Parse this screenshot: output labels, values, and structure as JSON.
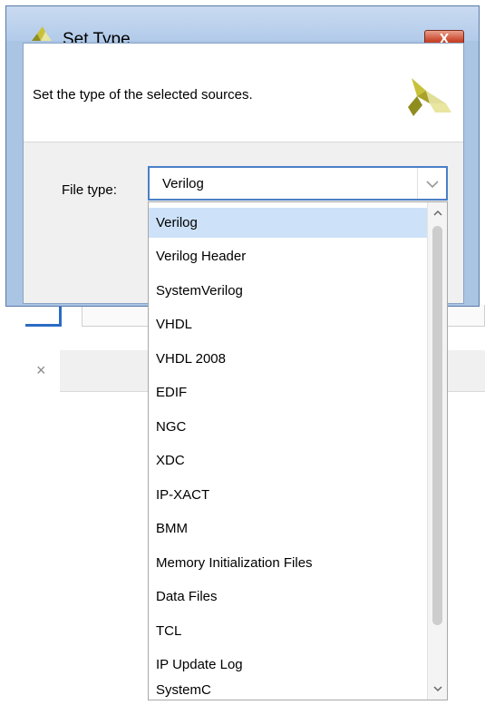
{
  "dialog": {
    "title": "Set Type",
    "close_label": "X",
    "description": "Set the type of the selected sources."
  },
  "file_type": {
    "label": "File type:",
    "selected_value": "Verilog",
    "options": [
      "Verilog",
      "Verilog Header",
      "SystemVerilog",
      "VHDL",
      "VHDL 2008",
      "EDIF",
      "NGC",
      "XDC",
      "IP-XACT",
      "BMM",
      "Memory Initialization Files",
      "Data Files",
      "TCL",
      "IP Update Log",
      "SystemC"
    ]
  },
  "background": {
    "tab_close_label": "×"
  },
  "colors": {
    "selection": "#cde2f8",
    "combo_focus_border": "#4a7fc7",
    "close_button": "#c9452a",
    "logo_yellow": "#e8e6a0",
    "logo_olive": "#8f8d1e"
  },
  "icons": {
    "title": "vivado-logo-icon",
    "header": "vivado-logo-icon",
    "combo": "chevron-down-icon"
  }
}
